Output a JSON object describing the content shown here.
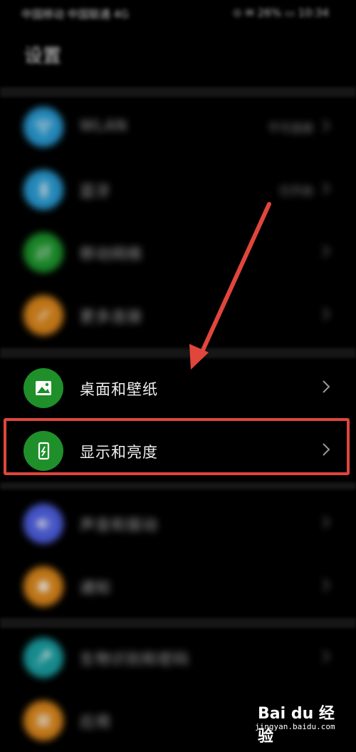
{
  "status_bar": {
    "left_text": "中国移动 中国联通 4G",
    "right_text": "⊙ ✉ 26% ▭ 10:34"
  },
  "page": {
    "title": "设置"
  },
  "rows": [
    {
      "label": "WLAN",
      "value": "不可连接",
      "color": "#2a9fd8",
      "icon": "wifi-icon",
      "state": "blurred"
    },
    {
      "label": "蓝牙",
      "value": "已开启",
      "color": "#2a9fd8",
      "icon": "bluetooth-icon",
      "state": "blurred"
    },
    {
      "label": "移动网络",
      "value": "",
      "color": "#1e9a2e",
      "icon": "mobile-network-icon",
      "state": "blurred"
    },
    {
      "label": "更多连接",
      "value": "",
      "color": "#e08a1c",
      "icon": "link-icon",
      "state": "blurred"
    },
    {
      "label": "桌面和壁纸",
      "value": "",
      "color": "#1f8f2a",
      "icon": "image-icon",
      "state": "clear"
    },
    {
      "label": "显示和亮度",
      "value": "",
      "color": "#1f8f2a",
      "icon": "display-brightness-icon",
      "state": "clear"
    },
    {
      "label": "声音和振动",
      "value": "",
      "color": "#5163e8",
      "icon": "sound-icon",
      "state": "blurred"
    },
    {
      "label": "通知",
      "value": "",
      "color": "#e08a1c",
      "icon": "notification-icon",
      "state": "blurred"
    },
    {
      "label": "生物识别和密码",
      "value": "",
      "color": "#1ba3a6",
      "icon": "key-icon",
      "state": "blurred"
    },
    {
      "label": "应用",
      "value": "",
      "color": "#e08a1c",
      "icon": "apps-icon",
      "state": "blurred"
    }
  ],
  "annotation": {
    "arrow_color": "#e0463c",
    "highlight_color": "#e0463c"
  },
  "watermark": {
    "brand": "Bai du 经验",
    "sub": "jingyan.baidu.com"
  }
}
